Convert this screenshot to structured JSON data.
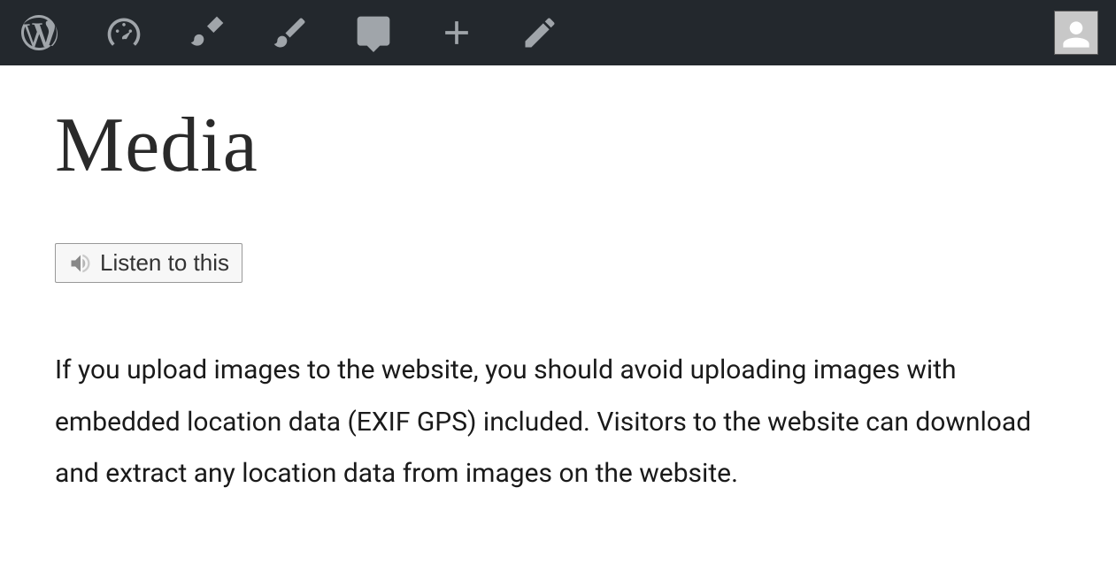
{
  "page": {
    "heading": "Media",
    "body": "If you upload images to the website, you should avoid uploading images with embedded location data (EXIF GPS) included. Visitors to the website can download and extract any location data from images on the website."
  },
  "buttons": {
    "listen": "Listen to this"
  }
}
